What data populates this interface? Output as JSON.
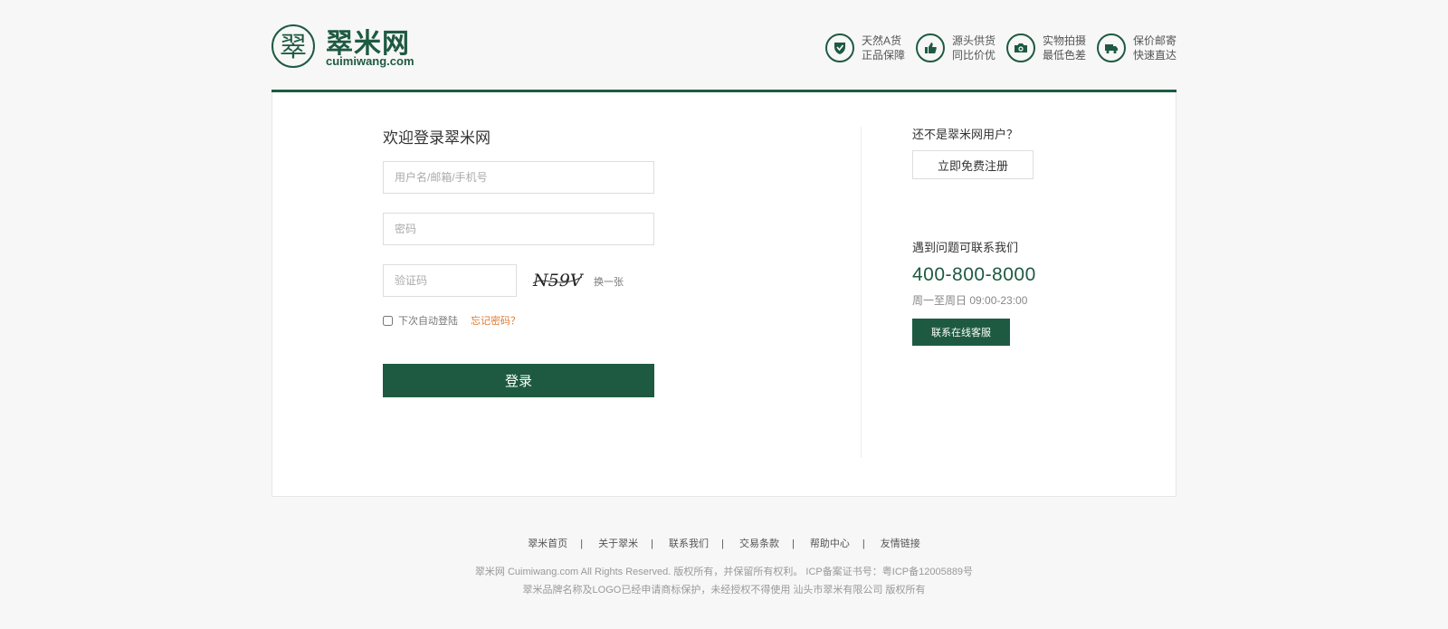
{
  "logo": {
    "seal_char": "翠",
    "name": "翠米网",
    "domain": "cuimiwang.com"
  },
  "features": [
    {
      "icon": "shield-check-icon",
      "line1": "天然A货",
      "line2": "正品保障"
    },
    {
      "icon": "thumbs-up-icon",
      "line1": "源头供货",
      "line2": "同比价优"
    },
    {
      "icon": "camera-icon",
      "line1": "实物拍摄",
      "line2": "最低色差"
    },
    {
      "icon": "delivery-truck-icon",
      "line1": "保价邮寄",
      "line2": "快速直达"
    }
  ],
  "login": {
    "title": "欢迎登录翠米网",
    "username_placeholder": "用户名/邮箱/手机号",
    "username_value": "",
    "password_placeholder": "密码",
    "password_value": "",
    "captcha_placeholder": "验证码",
    "captcha_value": "",
    "captcha_image_text": "N59V",
    "captcha_refresh": "换一张",
    "remember_label": "下次自动登陆",
    "remember_checked": false,
    "forgot": "忘记密码？",
    "submit": "登录"
  },
  "side": {
    "not_user": "还不是翠米网用户？",
    "register_button": "立即免费注册",
    "help_title": "遇到问题可联系我们",
    "phone": "400-800-8000",
    "hours": "周一至周日 09:00-23:00",
    "service_button": "联系在线客服"
  },
  "footer": {
    "links": [
      "翠米首页",
      "关于翠米",
      "联系我们",
      "交易条款",
      "帮助中心",
      "友情链接"
    ],
    "separator": "|",
    "copyright": "翠米网 Cuimiwang.com All Rights Reserved. 版权所有，并保留所有权利。 ICP备案证书号：粤ICP备12005889号",
    "trademark": "翠米品牌名称及LOGO已经申请商标保护，未经授权不得使用 汕头市翠米有限公司 版权所有"
  },
  "colors": {
    "brand_green": "#1e5a42",
    "accent_orange": "#e07a2f",
    "background": "#f7f7f7"
  }
}
